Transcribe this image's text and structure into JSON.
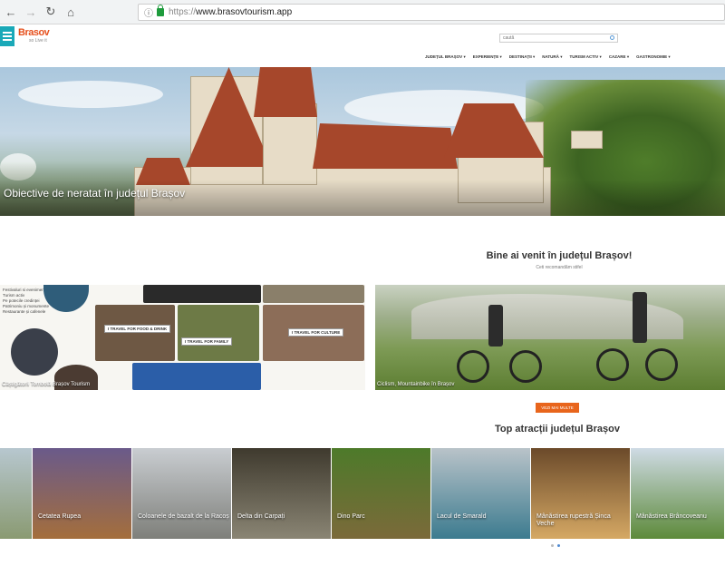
{
  "browser": {
    "back_icon": "back-arrow-icon",
    "forward_icon": "forward-arrow-icon",
    "reload_icon": "reload-icon",
    "home_icon": "home-icon",
    "url_protocol": "https://",
    "url_host": "www.brasovtourism.app"
  },
  "header": {
    "logo_text": "Brasov",
    "logo_tagline": "so Live it",
    "search_placeholder": "caută",
    "nav": [
      "JUDEȚUL BRAȘOV",
      "EXPERIENȚE",
      "DESTINAȚII",
      "NATURĂ",
      "TURISM ACTIV",
      "CAZARE",
      "GASTRONOMIE"
    ]
  },
  "hero": {
    "caption": "Obiective de neratat în județul Brașov"
  },
  "welcome": {
    "title": "Bine ai venit în județul Brașov!",
    "subtitle": "Ceti recomandăm stifel"
  },
  "promo_left": {
    "list": [
      "Festivaluri si evenimente",
      "Turism activ",
      "Pe potecile credinței",
      "Patrimoniu și monumente",
      "Restaurante și cafenele"
    ],
    "tags": [
      "FOOD & DRINK",
      "FAMILY",
      "CULTURE"
    ],
    "tag_prefix": "I TRAVEL FOR",
    "caption": "Câștigătorii Tombolă Brașov Tourism"
  },
  "promo_right": {
    "caption": "Ciclism, Mountainbike în Brașov"
  },
  "more_button": "VEZI MAI MULTE",
  "top_attractions": {
    "title": "Top atracții județul Brașov",
    "items": [
      {
        "label": "",
        "colors": [
          "#b7c7cf",
          "#8a9a72"
        ]
      },
      {
        "label": "Cetatea Rupea",
        "colors": [
          "#6a5a8a",
          "#a46e3c"
        ]
      },
      {
        "label": "Coloanele de bazalt de la Racoș",
        "colors": [
          "#c9cdd1",
          "#7e7f7a"
        ]
      },
      {
        "label": "Delta din Carpați",
        "colors": [
          "#3f3a2e",
          "#8a8574"
        ]
      },
      {
        "label": "Dino Parc",
        "colors": [
          "#4d7a2a",
          "#7b6a3a"
        ]
      },
      {
        "label": "Lacul de Smarald",
        "colors": [
          "#b9c3c9",
          "#3c7b8f"
        ]
      },
      {
        "label": "Mânăstirea rupestră Șinca Veche",
        "colors": [
          "#6b4a2a",
          "#d5a864"
        ]
      },
      {
        "label": "Mânăstirea Brâncoveanu",
        "colors": [
          "#cfdbe5",
          "#5d8a3a"
        ]
      }
    ]
  },
  "carousel": {
    "pages": 2,
    "active": 2
  }
}
